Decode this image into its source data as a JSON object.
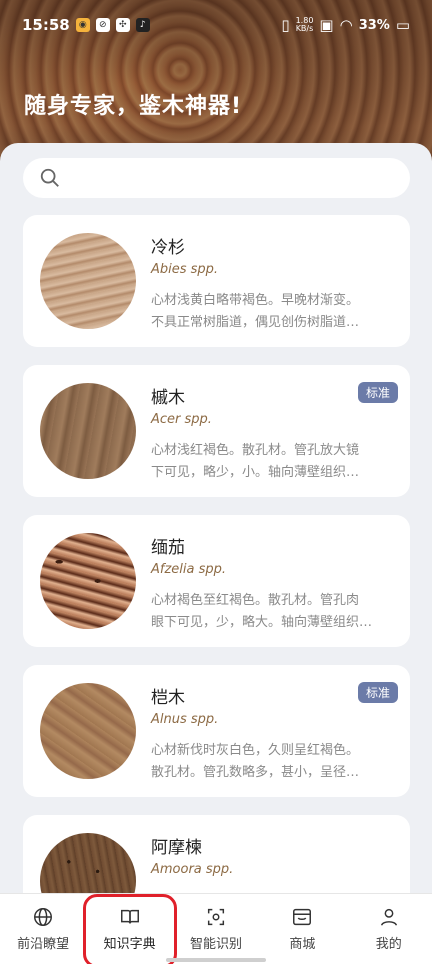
{
  "status_bar": {
    "time": "15:58",
    "net_speed_value": "1.80",
    "net_speed_unit": "KB/s",
    "battery": "33%"
  },
  "hero": {
    "slogan": "随身专家，鉴木神器!"
  },
  "search": {
    "placeholder": ""
  },
  "woods": [
    {
      "name": "冷杉",
      "latin": "Abies spp.",
      "desc_line1": "心材浅黄白略带褐色。早晚材渐变。",
      "desc_line2": "不具正常树脂道，偶见创伤树脂道…",
      "badge": ""
    },
    {
      "name": "槭木",
      "latin": "Acer spp.",
      "desc_line1": "心材浅红褐色。散孔材。管孔放大镜",
      "desc_line2": "下可见，略少，小。轴向薄壁组织…",
      "badge": "标准"
    },
    {
      "name": "缅茄",
      "latin": "Afzelia spp.",
      "desc_line1": "心材褐色至红褐色。散孔材。管孔肉",
      "desc_line2": "眼下可见，少，略大。轴向薄壁组织…",
      "badge": ""
    },
    {
      "name": "桤木",
      "latin": "Alnus spp.",
      "desc_line1": "心材新伐时灰白色，久则呈红褐色。",
      "desc_line2": "散孔材。管孔数略多，甚小，呈径…",
      "badge": "标准"
    },
    {
      "name": "阿摩楝",
      "latin": "Amoora spp.",
      "desc_line1": "",
      "desc_line2": "",
      "badge": ""
    }
  ],
  "tabbar": {
    "tabs": [
      {
        "label": "前沿瞭望",
        "icon": "globe-icon"
      },
      {
        "label": "知识字典",
        "icon": "book-icon"
      },
      {
        "label": "智能识别",
        "icon": "scan-icon"
      },
      {
        "label": "商城",
        "icon": "store-icon"
      },
      {
        "label": "我的",
        "icon": "user-icon"
      }
    ],
    "active_index": 1,
    "highlight_color": "#e0202a"
  },
  "colors": {
    "badge": "#6b7ba8",
    "latin_text": "#8c6a44",
    "background": "#eef0f4"
  }
}
